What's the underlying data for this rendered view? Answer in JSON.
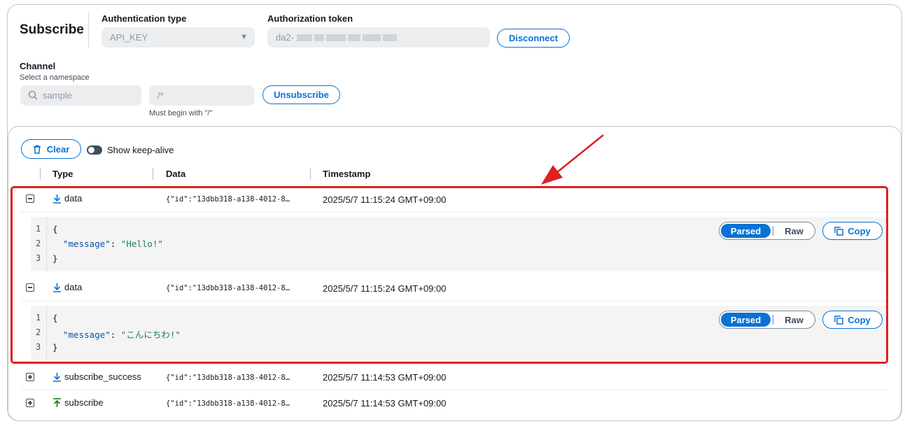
{
  "subscribe": {
    "title": "Subscribe",
    "auth_type_label": "Authentication type",
    "auth_type_value": "API_KEY",
    "auth_token_label": "Authorization token",
    "auth_token_prefix": "da2-",
    "disconnect_label": "Disconnect",
    "channel_label": "Channel",
    "channel_hint": "Select a namespace",
    "namespace_placeholder": "sample",
    "path_placeholder": "/*",
    "path_hint": "Must begin with \"/\"",
    "unsubscribe_label": "Unsubscribe"
  },
  "log": {
    "clear_label": "Clear",
    "keepalive_label": "Show keep-alive",
    "columns": {
      "type": "Type",
      "data": "Data",
      "timestamp": "Timestamp"
    },
    "rows": [
      {
        "type": "data",
        "direction": "download-icon",
        "data": "{\"id\":\"13dbb318-a138-4012-8…",
        "timestamp": "2025/5/7 11:15:24 GMT+09:00",
        "expanded": true,
        "code": {
          "l1": "{",
          "key": "\"message\"",
          "colon": ": ",
          "value": "\"Hello!\"",
          "l3": "}"
        }
      },
      {
        "type": "data",
        "direction": "download-icon",
        "data": "{\"id\":\"13dbb318-a138-4012-8…",
        "timestamp": "2025/5/7 11:15:24 GMT+09:00",
        "expanded": true,
        "code": {
          "l1": "{",
          "key": "\"message\"",
          "colon": ": ",
          "value": "\"こんにちわ!\"",
          "l3": "}"
        }
      },
      {
        "type": "subscribe_success",
        "direction": "download-icon",
        "data": "{\"id\":\"13dbb318-a138-4012-8…",
        "timestamp": "2025/5/7 11:14:53 GMT+09:00",
        "expanded": false
      },
      {
        "type": "subscribe",
        "direction": "upload-icon",
        "data": "{\"id\":\"13dbb318-a138-4012-8…",
        "timestamp": "2025/5/7 11:14:53 GMT+09:00",
        "expanded": false
      }
    ],
    "line_numbers": [
      "1",
      "2",
      "3"
    ],
    "parsed_label": "Parsed",
    "raw_label": "Raw",
    "copy_label": "Copy"
  },
  "colors": {
    "accent": "#0972d3",
    "highlight": "#dd2020",
    "upload_arrow": "#037f0c"
  }
}
